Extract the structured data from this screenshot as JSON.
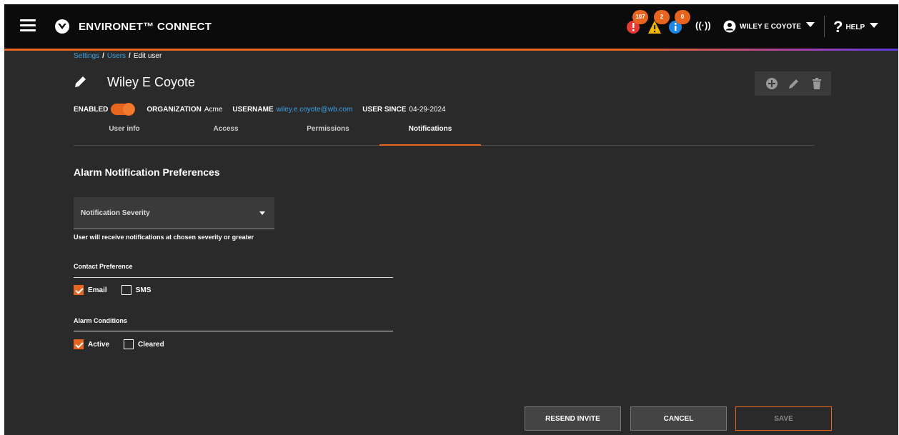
{
  "header": {
    "app_title": "ENVIRONET™ CONNECT",
    "alerts": [
      {
        "icon": "critical-alert-icon",
        "count": "107",
        "color": "#e53935"
      },
      {
        "icon": "warning-alert-icon",
        "count": "2",
        "color": "#f5b700"
      },
      {
        "icon": "info-alert-icon",
        "count": "0",
        "color": "#1e88e5"
      }
    ],
    "user_name": "WILEY E COYOTE",
    "help_label": "HELP"
  },
  "breadcrumb": {
    "settings": "Settings",
    "users": "Users",
    "current": "Edit user",
    "separator": "/"
  },
  "page": {
    "title": "Wiley E Coyote"
  },
  "meta": {
    "enabled_label": "ENABLED",
    "enabled": true,
    "organization_label": "ORGANIZATION",
    "organization": "Acme",
    "username_label": "USERNAME",
    "username": "wiley.e.coyote@wb.com",
    "user_since_label": "USER SINCE",
    "user_since": "04-29-2024"
  },
  "tabs": [
    {
      "label": "User info",
      "active": false
    },
    {
      "label": "Access",
      "active": false
    },
    {
      "label": "Permissions",
      "active": false
    },
    {
      "label": "Notifications",
      "active": true
    }
  ],
  "notifications": {
    "section_title": "Alarm Notification Preferences",
    "severity_placeholder": "Notification Severity",
    "severity_hint": "User will receive notifications at chosen severity or greater",
    "contact_label": "Contact Preference",
    "contact_options": [
      {
        "label": "Email",
        "checked": true
      },
      {
        "label": "SMS",
        "checked": false
      }
    ],
    "conditions_label": "Alarm Conditions",
    "condition_options": [
      {
        "label": "Active",
        "checked": true
      },
      {
        "label": "Cleared",
        "checked": false
      }
    ]
  },
  "buttons": {
    "resend": "RESEND INVITE",
    "cancel": "CANCEL",
    "save": "SAVE"
  },
  "colors": {
    "accent": "#e8651f",
    "link": "#3da3e6",
    "background": "#2a2a2a"
  }
}
